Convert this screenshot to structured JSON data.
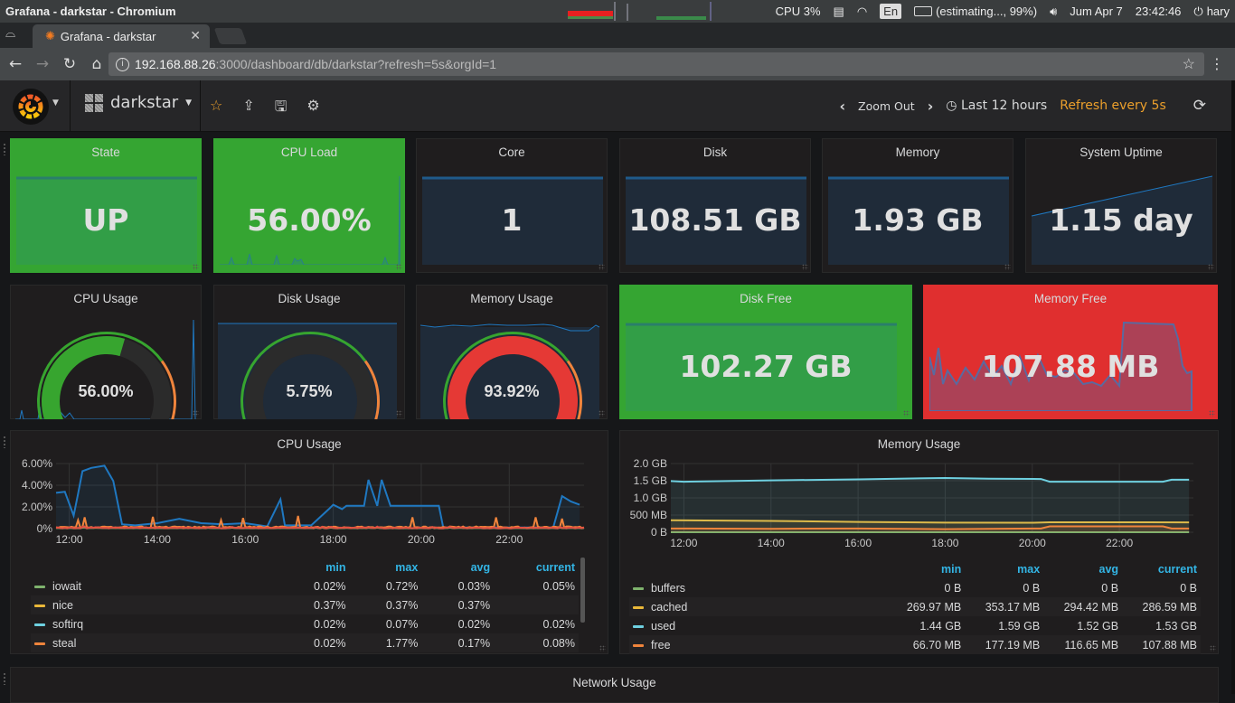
{
  "os": {
    "window_title": "Grafana - darkstar - Chromium",
    "cpu": "CPU 3%",
    "lang": "En",
    "battery": "(estimating..., 99%)",
    "date": "Jum Apr  7",
    "time": "23:42:46",
    "user": "hary"
  },
  "browser": {
    "tab_title": "Grafana - darkstar",
    "url_host": "192.168.88.26",
    "url_path": ":3000/dashboard/db/darkstar?refresh=5s&orgId=1"
  },
  "grafana": {
    "dashboard_name": "darkstar",
    "zoom_out": "Zoom Out",
    "time_range": "Last 12 hours",
    "refresh": "Refresh every 5s",
    "icons": [
      "star-icon",
      "share-icon",
      "save-icon",
      "gear-icon"
    ]
  },
  "singlestats": [
    {
      "title": "State",
      "value": "UP",
      "color": "green"
    },
    {
      "title": "CPU Load",
      "value": "56.00%",
      "color": "green"
    },
    {
      "title": "Core",
      "value": "1",
      "color": "dark"
    },
    {
      "title": "Disk",
      "value": "108.51 GB",
      "color": "dark"
    },
    {
      "title": "Memory",
      "value": "1.93 GB",
      "color": "dark"
    },
    {
      "title": "System Uptime",
      "value": "1.15 day",
      "color": "dark"
    }
  ],
  "gauges": [
    {
      "title": "CPU Usage",
      "value": "56.00%",
      "percent": 56.0,
      "color": "#37a52f"
    },
    {
      "title": "Disk Usage",
      "value": "5.75%",
      "percent": 5.75,
      "color": "#37a52f"
    },
    {
      "title": "Memory Usage",
      "value": "93.92%",
      "percent": 93.92,
      "color": "#e53935"
    }
  ],
  "free_stats": [
    {
      "title": "Disk Free",
      "value": "102.27 GB",
      "color": "green"
    },
    {
      "title": "Memory Free",
      "value": "107.88 MB",
      "color": "red"
    }
  ],
  "network_panel": {
    "title": "Network Usage"
  },
  "chart_data": [
    {
      "type": "line",
      "title": "CPU Usage",
      "x_ticks": [
        "12:00",
        "14:00",
        "16:00",
        "18:00",
        "20:00",
        "22:00"
      ],
      "y_ticks": [
        "0%",
        "2.00%",
        "4.00%",
        "6.00%"
      ],
      "ylim": [
        0,
        6
      ],
      "legend_headers": [
        "min",
        "max",
        "avg",
        "current"
      ],
      "series": [
        {
          "name": "iowait",
          "color": "#7eb26d",
          "min": "0.02%",
          "max": "0.72%",
          "avg": "0.03%",
          "current": "0.05%"
        },
        {
          "name": "nice",
          "color": "#eab839",
          "min": "0.37%",
          "max": "0.37%",
          "avg": "0.37%",
          "current": ""
        },
        {
          "name": "softirq",
          "color": "#6ed0e0",
          "min": "0.02%",
          "max": "0.07%",
          "avg": "0.02%",
          "current": "0.02%"
        },
        {
          "name": "steal",
          "color": "#ef843c",
          "min": "0.02%",
          "max": "1.77%",
          "avg": "0.17%",
          "current": "0.08%"
        }
      ],
      "main_series_hours": [
        11.7,
        11.9,
        12.1,
        12.2,
        12.3,
        12.5,
        12.8,
        13.0,
        13.2,
        13.5,
        14.0,
        14.5,
        15.0,
        15.5,
        16.0,
        16.5,
        16.8,
        16.9,
        17.0,
        17.5,
        17.9,
        18.0,
        18.2,
        18.3,
        18.7,
        18.8,
        19.0,
        19.1,
        19.3,
        19.5,
        20.0,
        20.4,
        20.5,
        21.0,
        22.0,
        23.0,
        23.2,
        23.4,
        23.6
      ],
      "main_series_values": [
        3.3,
        3.4,
        1.2,
        3.2,
        5.3,
        5.6,
        5.8,
        4.4,
        0.4,
        0.3,
        0.5,
        0.9,
        0.5,
        0.4,
        0.5,
        0.2,
        2.7,
        0.3,
        0.3,
        0.3,
        1.8,
        2.2,
        1.8,
        2.1,
        2.1,
        4.5,
        2.1,
        4.5,
        2.1,
        2.1,
        2.1,
        2.1,
        0.1,
        0.1,
        0.1,
        0.1,
        3.0,
        2.5,
        2.2
      ]
    },
    {
      "type": "line",
      "title": "Memory Usage",
      "x_ticks": [
        "12:00",
        "14:00",
        "16:00",
        "18:00",
        "20:00",
        "22:00"
      ],
      "y_ticks": [
        "0 B",
        "500 MB",
        "1.0 GB",
        "1.5 GB",
        "2.0 GB"
      ],
      "ylim_mb": [
        0,
        2000
      ],
      "legend_headers": [
        "min",
        "max",
        "avg",
        "current"
      ],
      "series": [
        {
          "name": "buffers",
          "color": "#7eb26d",
          "min": "0 B",
          "max": "0 B",
          "avg": "0 B",
          "current": "0 B",
          "hours": [
            11.7,
            23.6
          ],
          "values_mb": [
            0,
            0
          ]
        },
        {
          "name": "cached",
          "color": "#eab839",
          "min": "269.97 MB",
          "max": "353.17 MB",
          "avg": "294.42 MB",
          "current": "286.59 MB",
          "hours": [
            11.7,
            14,
            16,
            18,
            20,
            20.4,
            23.6
          ],
          "values_mb": [
            350,
            330,
            300,
            280,
            275,
            290,
            287
          ]
        },
        {
          "name": "used",
          "color": "#6ed0e0",
          "min": "1.44 GB",
          "max": "1.59 GB",
          "avg": "1.52 GB",
          "current": "1.53 GB",
          "hours": [
            11.7,
            12,
            14,
            16,
            18,
            19,
            20.2,
            20.4,
            23,
            23.2,
            23.6
          ],
          "values_mb": [
            1490,
            1470,
            1510,
            1540,
            1580,
            1560,
            1550,
            1470,
            1470,
            1530,
            1530
          ]
        },
        {
          "name": "free",
          "color": "#ef843c",
          "min": "66.70 MB",
          "max": "177.19 MB",
          "avg": "116.65 MB",
          "current": "107.88 MB",
          "hours": [
            11.7,
            14,
            16,
            18,
            19,
            20.2,
            20.4,
            23,
            23.2,
            23.6
          ],
          "values_mb": [
            110,
            100,
            110,
            90,
            100,
            110,
            170,
            170,
            110,
            108
          ]
        }
      ]
    }
  ]
}
